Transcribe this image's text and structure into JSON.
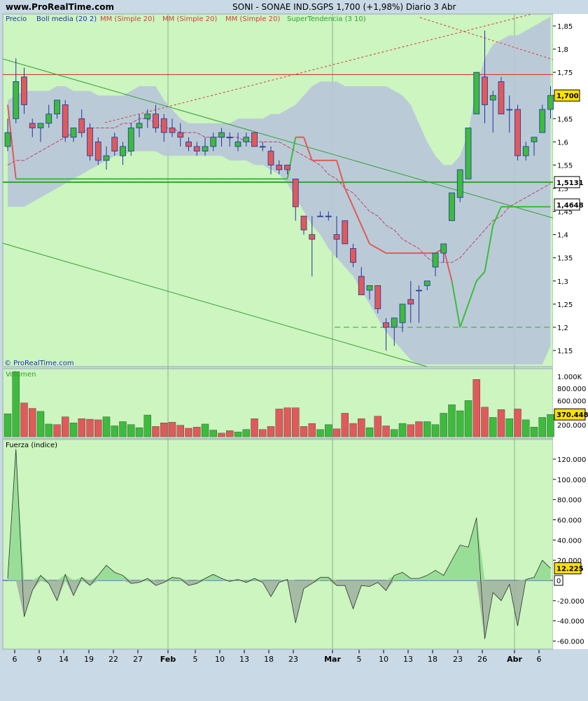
{
  "header": {
    "site": "www.ProRealTime.com",
    "title": "SONI - SONAE IND.SGPS    1,700 (+1,98%)   Diario  3 Abr"
  },
  "legend": {
    "price": "Precio",
    "boll": "Boll media (20 2)",
    "mm1": "MM (Simple 20)",
    "mm2": "MM (Simple 20)",
    "mm3": "MM (Simple 20)",
    "supertrend": "SuperTendencia (3 10)"
  },
  "watermark": "© ProRealTime.com",
  "colors": {
    "up": "#3dbb3d",
    "down": "#e05a5a",
    "plot_bg": "#ccf5c0",
    "band": "#b8c6d9",
    "mm": "#c3406a",
    "supertrend_up": "#3dbb3d",
    "supertrend_down": "#e05a5a",
    "red_line": "#d83a2a",
    "trend_green": "#35a035",
    "price_tag": "#ffe000"
  },
  "chart_data": [
    {
      "type": "candlestick",
      "name": "Precio",
      "x_labels": [
        "6",
        "9",
        "14",
        "19",
        "22",
        "27",
        "Feb",
        "5",
        "10",
        "13",
        "18",
        "23",
        "Mar",
        "5",
        "10",
        "13",
        "18",
        "23",
        "26",
        "Abr",
        "6"
      ],
      "y_ticks": [
        "1,85",
        "1,8",
        "1,75",
        "1,7",
        "1,65",
        "1,6",
        "1,55",
        "1,5",
        "1,45",
        "1,4",
        "1,35",
        "1,3",
        "1,25",
        "1,2",
        "1,15"
      ],
      "y_range": [
        1.12,
        1.87
      ],
      "candles": [
        [
          1.59,
          1.65,
          1.58,
          1.62
        ],
        [
          1.65,
          1.78,
          1.64,
          1.73
        ],
        [
          1.74,
          1.76,
          1.66,
          1.68
        ],
        [
          1.64,
          1.65,
          1.61,
          1.63
        ],
        [
          1.63,
          1.64,
          1.6,
          1.64
        ],
        [
          1.64,
          1.68,
          1.63,
          1.66
        ],
        [
          1.66,
          1.69,
          1.65,
          1.69
        ],
        [
          1.68,
          1.69,
          1.6,
          1.61
        ],
        [
          1.61,
          1.63,
          1.6,
          1.63
        ],
        [
          1.65,
          1.67,
          1.61,
          1.62
        ],
        [
          1.63,
          1.64,
          1.56,
          1.57
        ],
        [
          1.6,
          1.61,
          1.55,
          1.56
        ],
        [
          1.56,
          1.59,
          1.54,
          1.57
        ],
        [
          1.61,
          1.62,
          1.57,
          1.58
        ],
        [
          1.57,
          1.6,
          1.55,
          1.59
        ],
        [
          1.58,
          1.64,
          1.57,
          1.63
        ],
        [
          1.63,
          1.66,
          1.61,
          1.64
        ],
        [
          1.65,
          1.67,
          1.63,
          1.66
        ],
        [
          1.66,
          1.68,
          1.62,
          1.63
        ],
        [
          1.65,
          1.66,
          1.6,
          1.62
        ],
        [
          1.63,
          1.65,
          1.61,
          1.62
        ],
        [
          1.62,
          1.64,
          1.59,
          1.61
        ],
        [
          1.6,
          1.61,
          1.58,
          1.59
        ],
        [
          1.59,
          1.6,
          1.57,
          1.58
        ],
        [
          1.58,
          1.61,
          1.57,
          1.59
        ],
        [
          1.59,
          1.62,
          1.58,
          1.61
        ],
        [
          1.61,
          1.63,
          1.59,
          1.62
        ],
        [
          1.61,
          1.62,
          1.59,
          1.61
        ],
        [
          1.59,
          1.62,
          1.58,
          1.6
        ],
        [
          1.6,
          1.62,
          1.59,
          1.61
        ],
        [
          1.62,
          1.62,
          1.59,
          1.59
        ],
        [
          1.59,
          1.6,
          1.58,
          1.59
        ],
        [
          1.58,
          1.59,
          1.53,
          1.55
        ],
        [
          1.55,
          1.56,
          1.53,
          1.54
        ],
        [
          1.55,
          1.55,
          1.53,
          1.54
        ],
        [
          1.52,
          1.52,
          1.43,
          1.46
        ],
        [
          1.44,
          1.44,
          1.4,
          1.41
        ],
        [
          1.4,
          1.44,
          1.31,
          1.39
        ],
        [
          1.44,
          1.45,
          1.44,
          1.44
        ],
        [
          1.44,
          1.45,
          1.43,
          1.44
        ],
        [
          1.4,
          1.44,
          1.35,
          1.39
        ],
        [
          1.43,
          1.43,
          1.38,
          1.38
        ],
        [
          1.37,
          1.38,
          1.33,
          1.34
        ],
        [
          1.31,
          1.33,
          1.27,
          1.27
        ],
        [
          1.28,
          1.29,
          1.26,
          1.29
        ],
        [
          1.29,
          1.29,
          1.23,
          1.24
        ],
        [
          1.21,
          1.22,
          1.15,
          1.2
        ],
        [
          1.2,
          1.22,
          1.16,
          1.22
        ],
        [
          1.21,
          1.25,
          1.19,
          1.25
        ],
        [
          1.26,
          1.3,
          1.21,
          1.25
        ],
        [
          1.28,
          1.29,
          1.21,
          1.28
        ],
        [
          1.29,
          1.3,
          1.28,
          1.3
        ],
        [
          1.33,
          1.36,
          1.31,
          1.36
        ],
        [
          1.36,
          1.38,
          1.34,
          1.38
        ],
        [
          1.43,
          1.49,
          1.43,
          1.49
        ],
        [
          1.48,
          1.52,
          1.47,
          1.54
        ],
        [
          1.52,
          1.63,
          1.52,
          1.63
        ],
        [
          1.66,
          1.75,
          1.66,
          1.75
        ],
        [
          1.74,
          1.84,
          1.64,
          1.68
        ],
        [
          1.69,
          1.71,
          1.62,
          1.7
        ],
        [
          1.73,
          1.74,
          1.66,
          1.66
        ],
        [
          1.67,
          1.7,
          1.62,
          1.67
        ],
        [
          1.67,
          1.68,
          1.56,
          1.57
        ],
        [
          1.57,
          1.6,
          1.56,
          1.59
        ],
        [
          1.6,
          1.6,
          1.57,
          1.61
        ],
        [
          1.62,
          1.68,
          1.62,
          1.67
        ],
        [
          1.67,
          1.72,
          1.65,
          1.7
        ]
      ],
      "bollinger_upper": [
        1.69,
        1.7,
        1.71,
        1.71,
        1.71,
        1.71,
        1.72,
        1.72,
        1.71,
        1.71,
        1.71,
        1.7,
        1.7,
        1.7,
        1.7,
        1.71,
        1.72,
        1.72,
        1.72,
        1.69,
        1.67,
        1.65,
        1.64,
        1.64,
        1.64,
        1.64,
        1.64,
        1.64,
        1.65,
        1.65,
        1.65,
        1.65,
        1.66,
        1.66,
        1.67,
        1.68,
        1.7,
        1.72,
        1.73,
        1.73,
        1.73,
        1.72,
        1.72,
        1.72,
        1.72,
        1.72,
        1.72,
        1.71,
        1.7,
        1.68,
        1.64,
        1.6,
        1.57,
        1.55,
        1.55,
        1.57,
        1.62,
        1.72,
        1.78,
        1.81,
        1.82,
        1.83,
        1.83,
        1.84,
        1.85,
        1.86,
        1.87
      ],
      "bollinger_lower": [
        1.46,
        1.46,
        1.46,
        1.47,
        1.48,
        1.49,
        1.5,
        1.51,
        1.52,
        1.53,
        1.54,
        1.55,
        1.56,
        1.57,
        1.57,
        1.58,
        1.58,
        1.58,
        1.58,
        1.57,
        1.57,
        1.57,
        1.57,
        1.57,
        1.57,
        1.57,
        1.57,
        1.56,
        1.56,
        1.56,
        1.55,
        1.55,
        1.54,
        1.53,
        1.51,
        1.48,
        1.45,
        1.42,
        1.4,
        1.37,
        1.35,
        1.33,
        1.31,
        1.28,
        1.25,
        1.22,
        1.19,
        1.17,
        1.15,
        1.13,
        1.12,
        1.12,
        1.12,
        1.12,
        1.12,
        1.12,
        1.12,
        1.12,
        1.12,
        1.12,
        1.12,
        1.12,
        1.12,
        1.12,
        1.12,
        1.12,
        1.16
      ],
      "mm_simple_20": [
        1.55,
        1.56,
        1.56,
        1.57,
        1.58,
        1.59,
        1.6,
        1.61,
        1.62,
        1.62,
        1.63,
        1.63,
        1.63,
        1.63,
        1.64,
        1.64,
        1.65,
        1.65,
        1.64,
        1.63,
        1.63,
        1.62,
        1.62,
        1.62,
        1.61,
        1.61,
        1.61,
        1.61,
        1.61,
        1.6,
        1.6,
        1.6,
        1.6,
        1.6,
        1.59,
        1.58,
        1.57,
        1.56,
        1.55,
        1.53,
        1.52,
        1.5,
        1.49,
        1.47,
        1.45,
        1.44,
        1.42,
        1.41,
        1.39,
        1.38,
        1.37,
        1.35,
        1.34,
        1.34,
        1.34,
        1.35,
        1.37,
        1.39,
        1.41,
        1.43,
        1.44,
        1.46,
        1.47,
        1.48,
        1.49,
        1.5,
        1.51
      ],
      "supertrend": [
        1.68,
        1.52,
        1.52,
        1.52,
        1.52,
        1.52,
        1.52,
        1.52,
        1.52,
        1.52,
        1.52,
        1.52,
        1.52,
        1.52,
        1.52,
        1.52,
        1.52,
        1.52,
        1.52,
        1.52,
        1.52,
        1.52,
        1.52,
        1.52,
        1.52,
        1.52,
        1.52,
        1.52,
        1.52,
        1.52,
        1.52,
        1.52,
        1.52,
        1.52,
        1.52,
        1.61,
        1.61,
        1.56,
        1.56,
        1.56,
        1.56,
        1.5,
        1.46,
        1.42,
        1.38,
        1.37,
        1.36,
        1.36,
        1.36,
        1.36,
        1.36,
        1.36,
        1.36,
        1.37,
        1.3,
        1.2,
        1.25,
        1.3,
        1.32,
        1.42,
        1.46,
        1.46,
        1.46,
        1.46,
        1.46,
        1.46,
        1.46
      ],
      "supertrend_dir": [
        -1,
        1,
        1,
        1,
        1,
        1,
        1,
        1,
        1,
        1,
        1,
        1,
        1,
        1,
        1,
        1,
        1,
        1,
        1,
        1,
        1,
        1,
        1,
        1,
        1,
        1,
        1,
        1,
        1,
        1,
        1,
        1,
        1,
        1,
        1,
        -1,
        -1,
        -1,
        -1,
        -1,
        -1,
        -1,
        -1,
        -1,
        -1,
        -1,
        -1,
        -1,
        -1,
        -1,
        -1,
        -1,
        -1,
        -1,
        1,
        1,
        1,
        1,
        1,
        1,
        1,
        1,
        1,
        1,
        1,
        1,
        1
      ],
      "horizontal_lines": [
        1.745,
        1.5131,
        1.2
      ],
      "price_labels": [
        {
          "text": "1,700",
          "value": 1.7,
          "tag": "yellow"
        },
        {
          "text": "1,5131",
          "value": 1.5131,
          "tag": "white"
        },
        {
          "text": "1,4648",
          "value": 1.4648,
          "tag": "white"
        }
      ]
    },
    {
      "type": "bar",
      "name": "Volumen",
      "y_ticks": [
        "1.000K",
        "800.000",
        "600.000",
        "400.000",
        "200.000"
      ],
      "y_range": [
        0,
        1100000
      ],
      "current_label": "370.448",
      "values": [
        380000,
        1080000,
        560000,
        470000,
        420000,
        210000,
        200000,
        330000,
        230000,
        300000,
        290000,
        280000,
        330000,
        180000,
        250000,
        200000,
        150000,
        360000,
        170000,
        230000,
        240000,
        190000,
        140000,
        160000,
        210000,
        110000,
        60000,
        100000,
        80000,
        120000,
        300000,
        120000,
        170000,
        460000,
        480000,
        480000,
        170000,
        220000,
        120000,
        200000,
        130000,
        390000,
        220000,
        300000,
        150000,
        340000,
        180000,
        120000,
        220000,
        200000,
        250000,
        250000,
        200000,
        390000,
        530000,
        430000,
        600000,
        950000,
        490000,
        320000,
        450000,
        300000,
        460000,
        280000,
        160000,
        320000,
        370000
      ],
      "directions": [
        1,
        1,
        -1,
        -1,
        1,
        1,
        -1,
        -1,
        1,
        -1,
        -1,
        -1,
        1,
        1,
        1,
        1,
        1,
        1,
        -1,
        -1,
        -1,
        -1,
        -1,
        -1,
        1,
        1,
        -1,
        -1,
        1,
        1,
        -1,
        -1,
        -1,
        -1,
        -1,
        -1,
        -1,
        -1,
        1,
        1,
        -1,
        -1,
        -1,
        -1,
        1,
        -1,
        -1,
        1,
        1,
        -1,
        -1,
        1,
        1,
        1,
        1,
        1,
        1,
        -1,
        -1,
        1,
        -1,
        1,
        -1,
        1,
        1,
        1,
        1
      ]
    },
    {
      "type": "area",
      "name": "Fuerza (indice)",
      "y_ticks": [
        "120.000",
        "100.000",
        "80.000",
        "60.000",
        "40.000",
        "20.000",
        "0",
        "-20.000",
        "-40.000",
        "-60.000"
      ],
      "y_range": [
        -66000,
        140000
      ],
      "current_label": "12.225",
      "zero_label": "0",
      "values": [
        2000,
        130000,
        -36000,
        -10000,
        5000,
        -3000,
        -20000,
        6000,
        -15000,
        3000,
        -5000,
        5000,
        15000,
        8000,
        5000,
        -3000,
        -2000,
        2000,
        -5000,
        -2000,
        3000,
        2000,
        -5000,
        -3000,
        2000,
        6000,
        2000,
        -1000,
        1000,
        -2000,
        2000,
        -2000,
        -16000,
        -2000,
        1000,
        -42000,
        -8000,
        -3000,
        3000,
        3000,
        -5000,
        -5000,
        -28000,
        -5000,
        -6000,
        -2000,
        -10000,
        5000,
        8000,
        2000,
        2000,
        5000,
        10000,
        5000,
        20000,
        35000,
        33000,
        62000,
        -58000,
        -12000,
        -20000,
        -4000,
        -45000,
        1000,
        3000,
        20000,
        12000
      ]
    }
  ]
}
